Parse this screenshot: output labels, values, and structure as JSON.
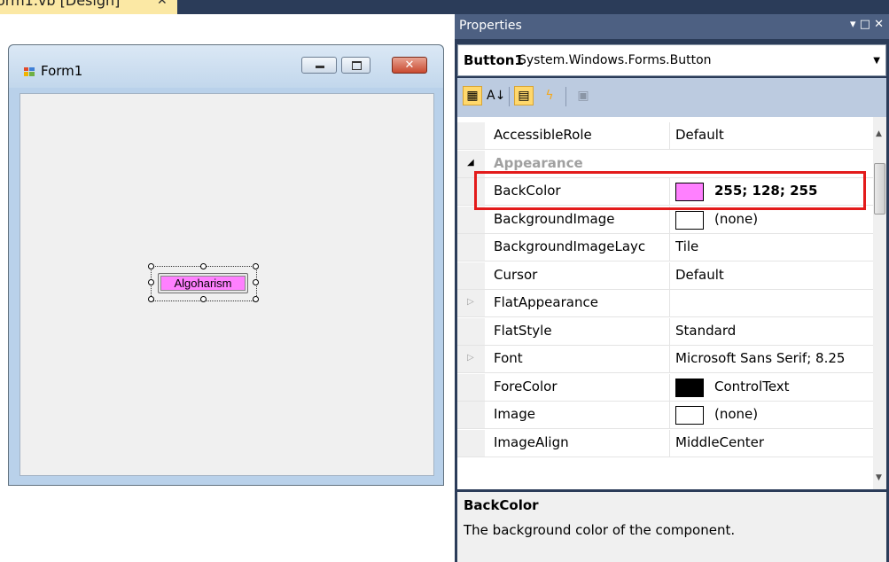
{
  "designer": {
    "tab_label": "orm1.vb [Design]",
    "tab_close": "✕",
    "form": {
      "title": "Form1",
      "icon": "form-icon",
      "close_glyph": "✕",
      "button_text": "Algoharism",
      "button_backcolor": "#ff80ff"
    }
  },
  "properties": {
    "title": "Properties",
    "title_controls": "▾ □ ✕",
    "object_name": "Button1",
    "object_type": "System.Windows.Forms.Button",
    "dropdown_glyph": "▼",
    "toolbar": {
      "categorized_icon": "▦",
      "alphabetical_icon": "A↓",
      "properties_icon": "▤",
      "events_icon": "ϟ",
      "property_pages_icon": "▣"
    },
    "rows": [
      {
        "name": "AccessibleRole",
        "value": "Default"
      },
      {
        "name": "Appearance",
        "category": true,
        "toggle": "◢"
      },
      {
        "name": "BackColor",
        "value": "255; 128; 255",
        "swatch": "#ff80ff"
      },
      {
        "name": "BackgroundImage",
        "value": "(none)",
        "swatch": "#ffffff"
      },
      {
        "name": "BackgroundImageLayc",
        "value": "Tile"
      },
      {
        "name": "Cursor",
        "value": "Default"
      },
      {
        "name": "FlatAppearance",
        "value": "",
        "expander": "▷"
      },
      {
        "name": "FlatStyle",
        "value": "Standard"
      },
      {
        "name": "Font",
        "value": "Microsoft Sans Serif; 8.25",
        "expander": "▷"
      },
      {
        "name": "ForeColor",
        "value": "ControlText",
        "swatch": "#000000"
      },
      {
        "name": "Image",
        "value": "(none)",
        "swatch": "#ffffff"
      },
      {
        "name": "ImageAlign",
        "value": "MiddleCenter"
      }
    ],
    "scroll_up": "▲",
    "scroll_down": "▼",
    "description": {
      "title": "BackColor",
      "text": "The background color of the component."
    }
  },
  "colors": {
    "highlight": "#e31b1b",
    "toolbar_active": "#ffd86c",
    "panel_dark": "#2b3c59"
  }
}
